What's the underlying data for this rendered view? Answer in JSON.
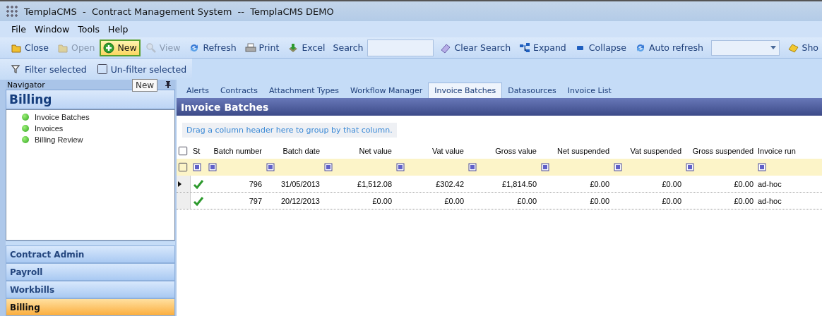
{
  "window": {
    "title": "TemplaCMS  -  Contract Management System  --  TemplaCMS DEMO"
  },
  "menu": [
    {
      "label": "File"
    },
    {
      "label": "Window"
    },
    {
      "label": "Tools"
    },
    {
      "label": "Help"
    }
  ],
  "toolbar": [
    {
      "kind": "button",
      "label": "Close",
      "disabled": false,
      "highlighted": false
    },
    {
      "kind": "button",
      "label": "Open",
      "disabled": true,
      "highlighted": false
    },
    {
      "kind": "button",
      "label": "New",
      "disabled": false,
      "highlighted": true
    },
    {
      "kind": "button",
      "label": "View",
      "disabled": true,
      "highlighted": false
    },
    {
      "kind": "button",
      "label": "Refresh",
      "disabled": false,
      "highlighted": false
    },
    {
      "kind": "button",
      "label": "Print",
      "disabled": false,
      "highlighted": false
    },
    {
      "kind": "button",
      "label": "Excel",
      "disabled": false,
      "highlighted": false
    },
    {
      "kind": "label",
      "label": "Search"
    },
    {
      "kind": "field"
    },
    {
      "kind": "button",
      "label": "Clear Search",
      "disabled": false,
      "highlighted": false
    },
    {
      "kind": "button",
      "label": "Expand",
      "disabled": false,
      "highlighted": false
    },
    {
      "kind": "button",
      "label": "Collapse",
      "disabled": false,
      "highlighted": false
    },
    {
      "kind": "button",
      "label": "Auto refresh",
      "disabled": false,
      "highlighted": false
    },
    {
      "kind": "dropdown"
    },
    {
      "kind": "button",
      "label": "Sho",
      "disabled": false,
      "highlighted": false
    }
  ],
  "toolbar2": [
    {
      "label": "Filter selected"
    },
    {
      "label": "Un-filter selected"
    }
  ],
  "tooltip": "New",
  "navigator": {
    "title": "Navigator",
    "heading": "Billing",
    "items": [
      {
        "label": "Invoice Batches"
      },
      {
        "label": "Invoices"
      },
      {
        "label": "Billing Review"
      }
    ],
    "groups": [
      {
        "label": "Contract Admin",
        "selected": false
      },
      {
        "label": "Payroll",
        "selected": false
      },
      {
        "label": "Workbills",
        "selected": false
      },
      {
        "label": "Billing",
        "selected": true
      }
    ]
  },
  "tabs": [
    {
      "label": "Alerts",
      "selected": false
    },
    {
      "label": "Contracts",
      "selected": false
    },
    {
      "label": "Attachment Types",
      "selected": false
    },
    {
      "label": "Workflow Manager",
      "selected": false
    },
    {
      "label": "Invoice Batches",
      "selected": true
    },
    {
      "label": "Datasources",
      "selected": false
    },
    {
      "label": "Invoice List",
      "selected": false
    }
  ],
  "panel": {
    "title": "Invoice Batches",
    "group_hint": "Drag a column header here to group by that column.",
    "status_column": "St",
    "columns": [
      {
        "label": "Batch number"
      },
      {
        "label": "Batch date"
      },
      {
        "label": "Net value"
      },
      {
        "label": "Vat value"
      },
      {
        "label": "Gross value"
      },
      {
        "label": "Net suspended"
      },
      {
        "label": "Vat suspended"
      },
      {
        "label": "Gross suspended"
      },
      {
        "label": "Invoice run"
      }
    ],
    "rows": [
      {
        "current": true,
        "completed": true,
        "cells": [
          "796",
          "31/05/2013",
          "£1,512.08",
          "£302.42",
          "£1,814.50",
          "£0.00",
          "£0.00",
          "£0.00",
          "ad-hoc"
        ]
      },
      {
        "current": false,
        "completed": true,
        "cells": [
          "797",
          "20/12/2013",
          "£0.00",
          "£0.00",
          "£0.00",
          "£0.00",
          "£0.00",
          "£0.00",
          "ad-hoc"
        ]
      }
    ]
  }
}
